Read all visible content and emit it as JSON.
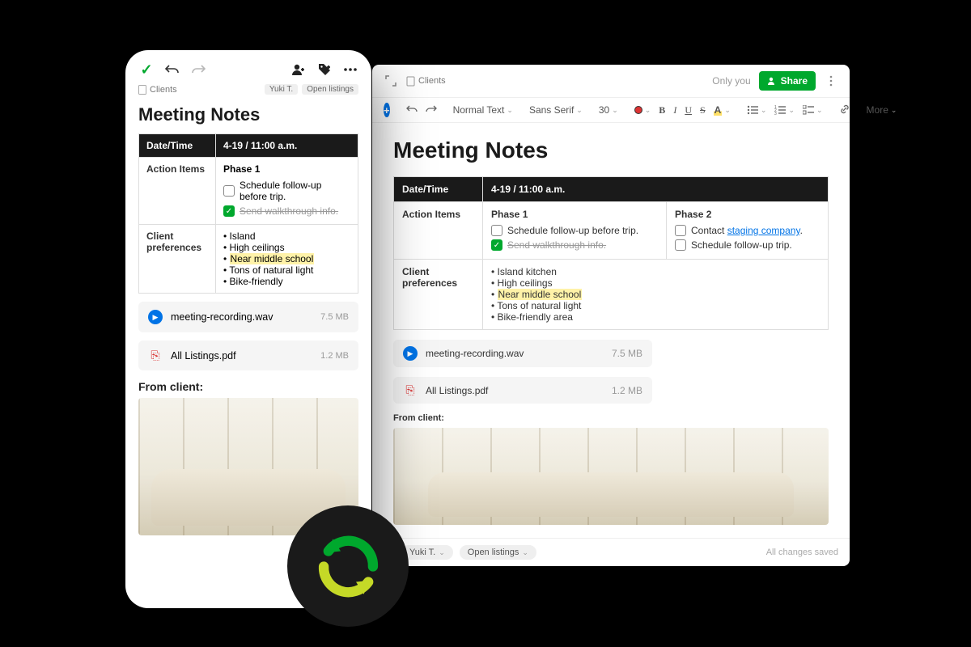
{
  "note": {
    "title": "Meeting Notes",
    "notebook": "Clients",
    "datetime_label": "Date/Time",
    "datetime_value": "4-19 / 11:00 a.m.",
    "action_items_label": "Action Items",
    "phase1": {
      "title": "Phase 1",
      "item1": "Schedule follow-up before trip.",
      "item2": "Send walkthrough info."
    },
    "phase2": {
      "title": "Phase 2",
      "item1_prefix": "Contact ",
      "item1_link": "staging company",
      "item1_suffix": ".",
      "item2": "Schedule follow-up trip."
    },
    "prefs_label": "Client preferences",
    "prefs_desktop": [
      "Island kitchen",
      "High ceilings",
      "Near middle school",
      "Tons of natural light",
      "Bike-friendly area"
    ],
    "prefs_mobile": [
      "Island",
      "High ceilings",
      "Near middle school",
      "Tons of natural light",
      "Bike-friendly"
    ],
    "attachments": [
      {
        "name": "meeting-recording.wav",
        "size": "7.5 MB",
        "kind": "audio"
      },
      {
        "name": "All Listings.pdf",
        "size": "1.2 MB",
        "kind": "pdf"
      }
    ],
    "from_client_label": "From client:"
  },
  "desktop": {
    "only_you": "Only you",
    "share": "Share",
    "toolbar": {
      "style": "Normal Text",
      "font": "Sans Serif",
      "size": "30",
      "more": "More"
    },
    "footer": {
      "tag1": "Yuki T.",
      "tag2": "Open listings",
      "saved": "All changes saved"
    }
  },
  "mobile": {
    "tag1": "Yuki T.",
    "tag2": "Open listings"
  }
}
